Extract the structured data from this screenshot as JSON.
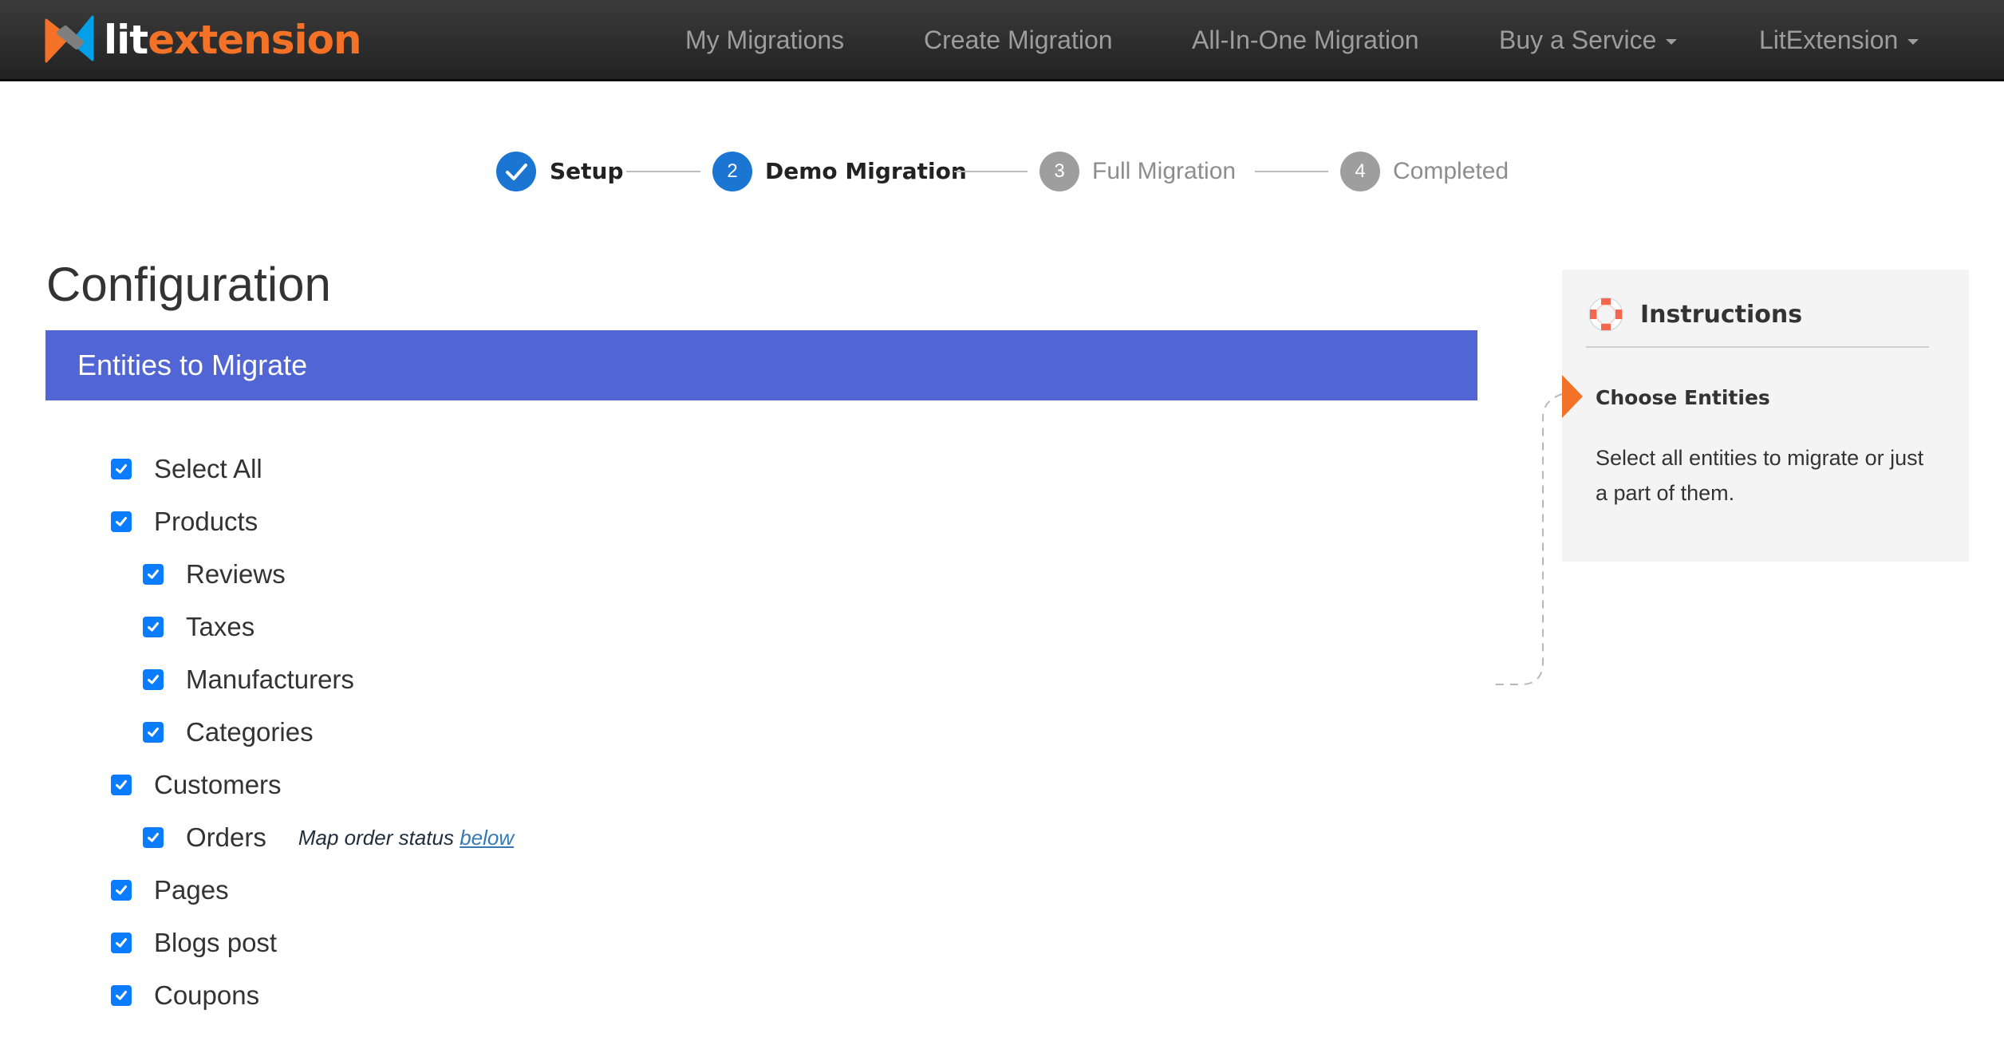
{
  "brand": {
    "name_part1": "lit",
    "name_part2": "extension",
    "colors": {
      "orange": "#f47227",
      "blue": "#00a0e9",
      "gray": "#7f7f7f"
    }
  },
  "nav": {
    "items": [
      {
        "label": "My Migrations",
        "dropdown": false
      },
      {
        "label": "Create Migration",
        "dropdown": false
      },
      {
        "label": "All-In-One Migration",
        "dropdown": false
      },
      {
        "label": "Buy a Service",
        "dropdown": true
      },
      {
        "label": "LitExtension",
        "dropdown": true
      }
    ]
  },
  "stepper": {
    "steps": [
      {
        "number": "1",
        "label": "Setup",
        "state": "done"
      },
      {
        "number": "2",
        "label": "Demo Migration",
        "state": "current"
      },
      {
        "number": "3",
        "label": "Full Migration",
        "state": "pending"
      },
      {
        "number": "4",
        "label": "Completed",
        "state": "pending"
      }
    ],
    "colors": {
      "active": "#1a76d2",
      "pending": "#9e9e9e"
    }
  },
  "main": {
    "title": "Configuration",
    "section_title": "Entities to Migrate",
    "section_color": "#5166d4",
    "entities": [
      {
        "label": "Select All",
        "checked": true,
        "level": 0
      },
      {
        "label": "Products",
        "checked": true,
        "level": 0
      },
      {
        "label": "Reviews",
        "checked": true,
        "level": 1
      },
      {
        "label": "Taxes",
        "checked": true,
        "level": 1
      },
      {
        "label": "Manufacturers",
        "checked": true,
        "level": 1
      },
      {
        "label": "Categories",
        "checked": true,
        "level": 1
      },
      {
        "label": "Customers",
        "checked": true,
        "level": 0
      },
      {
        "label": "Orders",
        "checked": true,
        "level": 1,
        "note": "Map order status",
        "note_link": "below"
      },
      {
        "label": "Pages",
        "checked": true,
        "level": 0
      },
      {
        "label": "Blogs post",
        "checked": true,
        "level": 0
      },
      {
        "label": "Coupons",
        "checked": true,
        "level": 0
      }
    ]
  },
  "sidebar": {
    "title": "Instructions",
    "icon": "lifebuoy-icon",
    "subtitle": "Choose Entities",
    "text": "Select all entities to migrate or just a part of them."
  }
}
